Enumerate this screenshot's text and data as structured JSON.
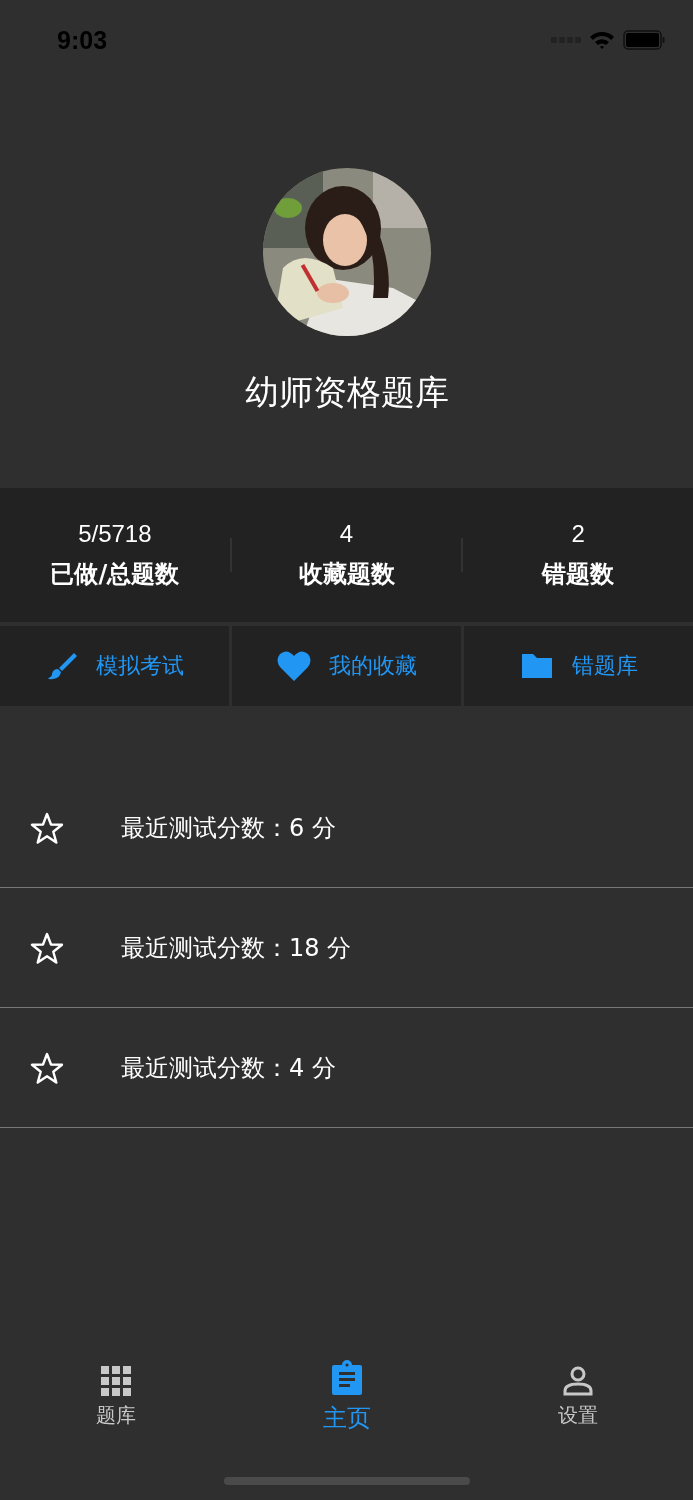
{
  "status_bar": {
    "time": "9:03"
  },
  "profile": {
    "title": "幼师资格题库"
  },
  "stats": [
    {
      "value": "5/5718",
      "label": "已做/总题数"
    },
    {
      "value": "4",
      "label": "收藏题数"
    },
    {
      "value": "2",
      "label": "错题数"
    }
  ],
  "actions": [
    {
      "kind": "brush",
      "label": "模拟考试"
    },
    {
      "kind": "heart",
      "label": "我的收藏"
    },
    {
      "kind": "folder",
      "label": "错题库"
    }
  ],
  "records": [
    {
      "text": "最近测试分数：6 分"
    },
    {
      "text": "最近测试分数：18 分"
    },
    {
      "text": "最近测试分数：4 分"
    }
  ],
  "tab_bar": [
    {
      "kind": "grid",
      "label": "题库",
      "selected": false
    },
    {
      "kind": "clipboard",
      "label": "主页",
      "selected": true
    },
    {
      "kind": "person",
      "label": "设置",
      "selected": false
    }
  ]
}
